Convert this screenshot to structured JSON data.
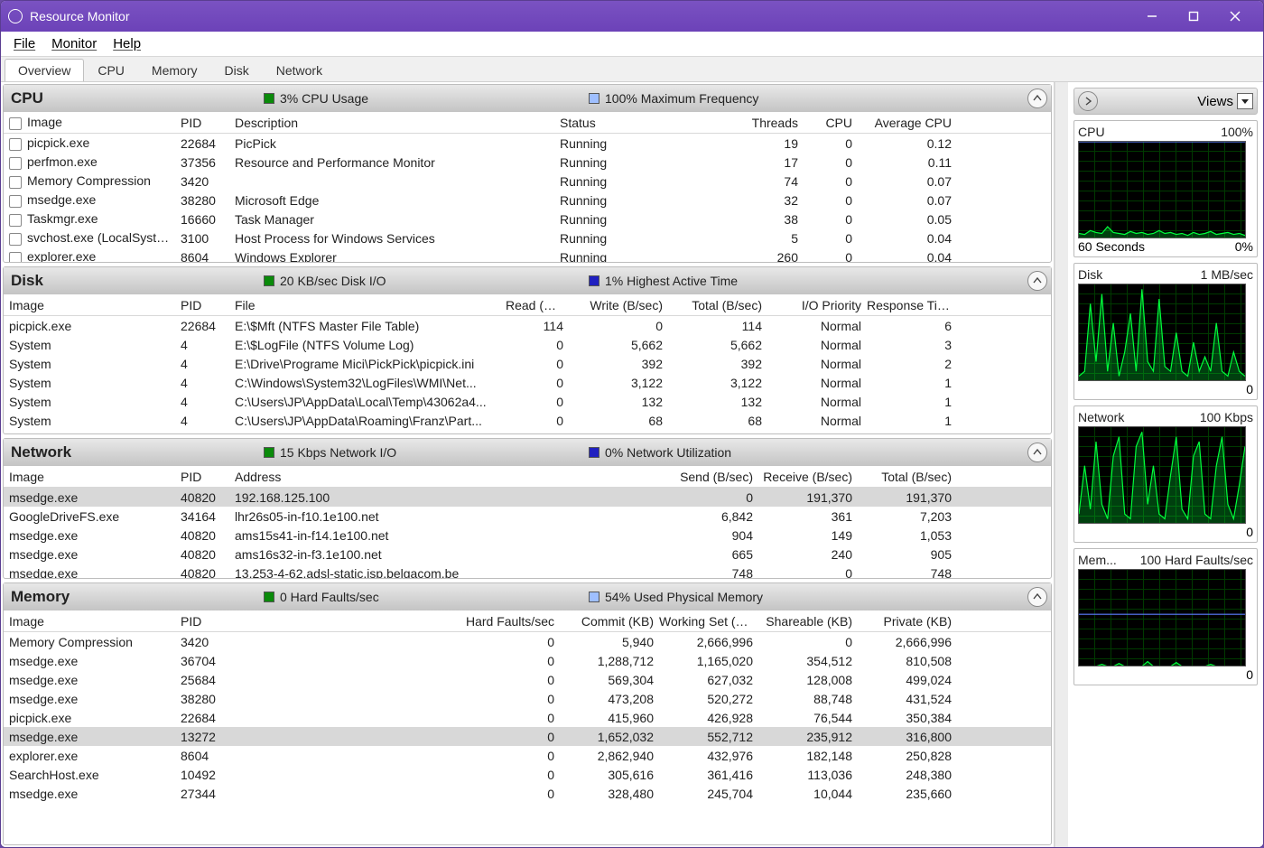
{
  "window": {
    "title": "Resource Monitor"
  },
  "menu": {
    "file": "File",
    "monitor": "Monitor",
    "help": "Help"
  },
  "tabs": {
    "overview": "Overview",
    "cpu": "CPU",
    "memory": "Memory",
    "disk": "Disk",
    "network": "Network"
  },
  "cpu": {
    "title": "CPU",
    "metric1": "3% CPU Usage",
    "metric2": "100% Maximum Frequency",
    "cols": {
      "image": "Image",
      "pid": "PID",
      "desc": "Description",
      "status": "Status",
      "threads": "Threads",
      "cpu": "CPU",
      "avg": "Average CPU"
    },
    "rows": [
      {
        "image": "picpick.exe",
        "pid": "22684",
        "desc": "PicPick",
        "status": "Running",
        "threads": "19",
        "cpu": "0",
        "avg": "0.12"
      },
      {
        "image": "perfmon.exe",
        "pid": "37356",
        "desc": "Resource and Performance Monitor",
        "status": "Running",
        "threads": "17",
        "cpu": "0",
        "avg": "0.11"
      },
      {
        "image": "Memory Compression",
        "pid": "3420",
        "desc": "",
        "status": "Running",
        "threads": "74",
        "cpu": "0",
        "avg": "0.07"
      },
      {
        "image": "msedge.exe",
        "pid": "38280",
        "desc": "Microsoft Edge",
        "status": "Running",
        "threads": "32",
        "cpu": "0",
        "avg": "0.07"
      },
      {
        "image": "Taskmgr.exe",
        "pid": "16660",
        "desc": "Task Manager",
        "status": "Running",
        "threads": "38",
        "cpu": "0",
        "avg": "0.05"
      },
      {
        "image": "svchost.exe (LocalSystemNet...",
        "pid": "3100",
        "desc": "Host Process for Windows Services",
        "status": "Running",
        "threads": "5",
        "cpu": "0",
        "avg": "0.04"
      },
      {
        "image": "explorer.exe",
        "pid": "8604",
        "desc": "Windows Explorer",
        "status": "Running",
        "threads": "260",
        "cpu": "0",
        "avg": "0.04"
      }
    ]
  },
  "disk": {
    "title": "Disk",
    "metric1": "20 KB/sec Disk I/O",
    "metric2": "1% Highest Active Time",
    "cols": {
      "image": "Image",
      "pid": "PID",
      "file": "File",
      "read": "Read (B/sec)",
      "write": "Write (B/sec)",
      "total": "Total (B/sec)",
      "prio": "I/O Priority",
      "resp": "Response Time..."
    },
    "rows": [
      {
        "image": "picpick.exe",
        "pid": "22684",
        "file": "E:\\$Mft (NTFS Master File Table)",
        "read": "114",
        "write": "0",
        "total": "114",
        "prio": "Normal",
        "resp": "6"
      },
      {
        "image": "System",
        "pid": "4",
        "file": "E:\\$LogFile (NTFS Volume Log)",
        "read": "0",
        "write": "5,662",
        "total": "5,662",
        "prio": "Normal",
        "resp": "3"
      },
      {
        "image": "System",
        "pid": "4",
        "file": "E:\\Drive\\Programe Mici\\PickPick\\picpick.ini",
        "read": "0",
        "write": "392",
        "total": "392",
        "prio": "Normal",
        "resp": "2"
      },
      {
        "image": "System",
        "pid": "4",
        "file": "C:\\Windows\\System32\\LogFiles\\WMI\\Net...",
        "read": "0",
        "write": "3,122",
        "total": "3,122",
        "prio": "Normal",
        "resp": "1"
      },
      {
        "image": "System",
        "pid": "4",
        "file": "C:\\Users\\JP\\AppData\\Local\\Temp\\43062a4...",
        "read": "0",
        "write": "132",
        "total": "132",
        "prio": "Normal",
        "resp": "1"
      },
      {
        "image": "System",
        "pid": "4",
        "file": "C:\\Users\\JP\\AppData\\Roaming\\Franz\\Part...",
        "read": "0",
        "write": "68",
        "total": "68",
        "prio": "Normal",
        "resp": "1"
      }
    ]
  },
  "network": {
    "title": "Network",
    "metric1": "15 Kbps Network I/O",
    "metric2": "0% Network Utilization",
    "cols": {
      "image": "Image",
      "pid": "PID",
      "addr": "Address",
      "send": "Send (B/sec)",
      "recv": "Receive (B/sec)",
      "total": "Total (B/sec)"
    },
    "rows": [
      {
        "sel": true,
        "image": "msedge.exe",
        "pid": "40820",
        "addr": "192.168.125.100",
        "send": "0",
        "recv": "191,370",
        "total": "191,370"
      },
      {
        "image": "GoogleDriveFS.exe",
        "pid": "34164",
        "addr": "lhr26s05-in-f10.1e100.net",
        "send": "6,842",
        "recv": "361",
        "total": "7,203"
      },
      {
        "image": "msedge.exe",
        "pid": "40820",
        "addr": "ams15s41-in-f14.1e100.net",
        "send": "904",
        "recv": "149",
        "total": "1,053"
      },
      {
        "image": "msedge.exe",
        "pid": "40820",
        "addr": "ams16s32-in-f3.1e100.net",
        "send": "665",
        "recv": "240",
        "total": "905"
      },
      {
        "image": "msedge.exe",
        "pid": "40820",
        "addr": "13.253-4-62.adsl-static.isp.belgacom.be",
        "send": "748",
        "recv": "0",
        "total": "748"
      }
    ]
  },
  "memory": {
    "title": "Memory",
    "metric1": "0 Hard Faults/sec",
    "metric2": "54% Used Physical Memory",
    "cols": {
      "image": "Image",
      "pid": "PID",
      "faults": "Hard Faults/sec",
      "commit": "Commit (KB)",
      "ws": "Working Set (KB)",
      "share": "Shareable (KB)",
      "priv": "Private (KB)"
    },
    "rows": [
      {
        "image": "Memory Compression",
        "pid": "3420",
        "faults": "0",
        "commit": "5,940",
        "ws": "2,666,996",
        "share": "0",
        "priv": "2,666,996"
      },
      {
        "image": "msedge.exe",
        "pid": "36704",
        "faults": "0",
        "commit": "1,288,712",
        "ws": "1,165,020",
        "share": "354,512",
        "priv": "810,508"
      },
      {
        "image": "msedge.exe",
        "pid": "25684",
        "faults": "0",
        "commit": "569,304",
        "ws": "627,032",
        "share": "128,008",
        "priv": "499,024"
      },
      {
        "image": "msedge.exe",
        "pid": "38280",
        "faults": "0",
        "commit": "473,208",
        "ws": "520,272",
        "share": "88,748",
        "priv": "431,524"
      },
      {
        "image": "picpick.exe",
        "pid": "22684",
        "faults": "0",
        "commit": "415,960",
        "ws": "426,928",
        "share": "76,544",
        "priv": "350,384"
      },
      {
        "sel": true,
        "image": "msedge.exe",
        "pid": "13272",
        "faults": "0",
        "commit": "1,652,032",
        "ws": "552,712",
        "share": "235,912",
        "priv": "316,800"
      },
      {
        "image": "explorer.exe",
        "pid": "8604",
        "faults": "0",
        "commit": "2,862,940",
        "ws": "432,976",
        "share": "182,148",
        "priv": "250,828"
      },
      {
        "image": "SearchHost.exe",
        "pid": "10492",
        "faults": "0",
        "commit": "305,616",
        "ws": "361,416",
        "share": "113,036",
        "priv": "248,380"
      },
      {
        "image": "msedge.exe",
        "pid": "27344",
        "faults": "0",
        "commit": "328,480",
        "ws": "245,704",
        "share": "10,044",
        "priv": "235,660"
      }
    ]
  },
  "side": {
    "views": "Views",
    "cpu": {
      "title": "CPU",
      "scale": "100%",
      "footL": "60 Seconds",
      "footR": "0%"
    },
    "disk": {
      "title": "Disk",
      "scale": "1 MB/sec",
      "footR": "0"
    },
    "net": {
      "title": "Network",
      "scale": "100 Kbps",
      "footR": "0"
    },
    "mem": {
      "title": "Mem...",
      "scale": "100 Hard Faults/sec",
      "footR": "0"
    }
  },
  "chart_data": [
    {
      "type": "line",
      "title": "CPU",
      "ylim": [
        0,
        100
      ],
      "xlabel": "60 Seconds",
      "series": [
        {
          "name": "usage",
          "values": [
            5,
            4,
            8,
            6,
            5,
            12,
            6,
            5,
            4,
            7,
            5,
            6,
            4,
            5,
            8,
            5,
            6,
            4,
            5,
            3,
            6,
            4,
            5,
            7,
            4,
            5,
            6,
            4,
            5,
            3
          ]
        },
        {
          "name": "max_freq",
          "values": [
            100,
            100,
            100,
            100,
            100,
            100,
            100,
            100,
            100,
            100,
            100,
            100,
            100,
            100,
            100,
            100,
            100,
            100,
            100,
            100,
            100,
            100,
            100,
            100,
            100,
            100,
            100,
            100,
            100,
            100
          ]
        }
      ]
    },
    {
      "type": "line",
      "title": "Disk",
      "ylim": [
        0,
        1
      ],
      "ylabel": "MB/sec",
      "series": [
        {
          "name": "io",
          "values": [
            0.05,
            0.1,
            0.8,
            0.2,
            0.9,
            0.1,
            0.6,
            0.05,
            0.3,
            0.7,
            0.1,
            0.95,
            0.2,
            0.1,
            0.85,
            0.15,
            0.1,
            0.5,
            0.1,
            0.05,
            0.4,
            0.1,
            0.25,
            0.1,
            0.6,
            0.1,
            0.05,
            0.3,
            0.1,
            0.05
          ]
        }
      ]
    },
    {
      "type": "line",
      "title": "Network",
      "ylim": [
        0,
        100
      ],
      "ylabel": "Kbps",
      "series": [
        {
          "name": "io",
          "values": [
            10,
            60,
            15,
            85,
            20,
            5,
            70,
            90,
            10,
            5,
            80,
            95,
            20,
            60,
            10,
            5,
            50,
            90,
            15,
            5,
            70,
            85,
            10,
            5,
            60,
            90,
            20,
            5,
            40,
            80
          ]
        }
      ]
    },
    {
      "type": "line",
      "title": "Memory",
      "ylim": [
        0,
        100
      ],
      "ylabel": "Hard Faults/sec",
      "series": [
        {
          "name": "faults",
          "values": [
            0,
            0,
            0,
            0,
            2,
            0,
            0,
            3,
            0,
            0,
            0,
            0,
            5,
            0,
            0,
            0,
            0,
            4,
            0,
            0,
            0,
            0,
            0,
            2,
            0,
            0,
            0,
            0,
            0,
            0
          ]
        },
        {
          "name": "used",
          "values": [
            54,
            54,
            54,
            54,
            54,
            54,
            54,
            54,
            54,
            54,
            54,
            54,
            54,
            54,
            54,
            54,
            54,
            54,
            54,
            54,
            54,
            54,
            54,
            54,
            54,
            54,
            54,
            54,
            54,
            54
          ]
        }
      ]
    }
  ]
}
